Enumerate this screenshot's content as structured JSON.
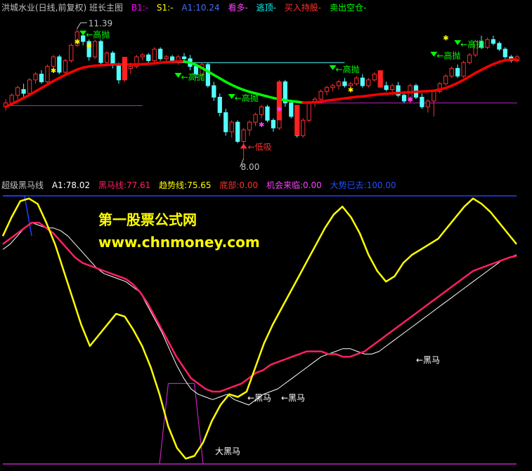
{
  "top_header": {
    "title": "洪城水业(日线,前复权) 班长主图",
    "b1": "B1:-",
    "s1": "S1:-",
    "a1": "A1:10.24",
    "kan_duo": "看多-",
    "tao_ding": "逃顶-",
    "buy_hold": "买入持股-",
    "sell_clear": "卖出空仓-"
  },
  "bottom_header": {
    "title": "超级黑马线",
    "a1": "A1:78.02",
    "heima_line": "黑马线:77.61",
    "trend_line": "趋势线:75.65",
    "bottom": "底部:0.00",
    "chance": "机会来临:0.00",
    "rise": "大势已去:100.00"
  },
  "watermark": {
    "line1": "第一股票公式网",
    "line2": "www.chnmoney.com"
  },
  "colors": {
    "up": "#ff3030",
    "down": "#54ffff",
    "trend_up": "#ff0000",
    "trend_down": "#00ff00",
    "yellow": "#ffff00",
    "white": "#ffffff",
    "crimson": "#ff2060",
    "blue": "#2040ff",
    "magenta": "#c020c0"
  },
  "annotations": {
    "high_price": "11.39",
    "low_price": "8.00",
    "low_buy": "低吸",
    "high_sell": "高抛",
    "dark_horse": "黑马",
    "big_dark_horse": "大黑马"
  },
  "chart_data": [
    {
      "type": "candlestick",
      "title": "洪城水业(日线,前复权) 班长主图",
      "ylim": [
        7.6,
        11.8
      ],
      "max_label": 11.39,
      "min_label": 8.0,
      "candles": [
        [
          9.35,
          9.55,
          9.25,
          9.45
        ],
        [
          9.45,
          9.7,
          9.4,
          9.65
        ],
        [
          9.65,
          9.9,
          9.55,
          9.85
        ],
        [
          9.8,
          9.95,
          9.6,
          9.7
        ],
        [
          9.7,
          10.1,
          9.65,
          10.05
        ],
        [
          10.05,
          10.25,
          9.95,
          10.2
        ],
        [
          10.2,
          10.3,
          9.95,
          10.0
        ],
        [
          10.0,
          10.45,
          9.95,
          10.4
        ],
        [
          10.4,
          10.7,
          10.3,
          10.65
        ],
        [
          10.65,
          10.7,
          10.2,
          10.25
        ],
        [
          10.25,
          10.6,
          10.2,
          10.55
        ],
        [
          10.55,
          11.0,
          10.5,
          10.95
        ],
        [
          10.95,
          11.39,
          10.9,
          11.3
        ],
        [
          11.2,
          11.3,
          10.95,
          11.05
        ],
        [
          11.05,
          11.1,
          10.55,
          10.65
        ],
        [
          10.65,
          11.1,
          10.6,
          11.05
        ],
        [
          11.05,
          11.1,
          10.45,
          10.5
        ],
        [
          10.5,
          10.8,
          10.45,
          10.75
        ],
        [
          10.75,
          10.8,
          10.35,
          10.45
        ],
        [
          10.45,
          10.5,
          9.95,
          10.05
        ],
        [
          10.05,
          10.4,
          10.0,
          10.35
        ],
        [
          10.35,
          10.5,
          10.2,
          10.4
        ],
        [
          10.4,
          10.7,
          10.35,
          10.65
        ],
        [
          10.65,
          10.75,
          10.55,
          10.7
        ],
        [
          10.7,
          10.75,
          10.5,
          10.55
        ],
        [
          10.55,
          10.9,
          10.5,
          10.85
        ],
        [
          10.85,
          10.9,
          10.55,
          10.6
        ],
        [
          10.6,
          10.7,
          10.5,
          10.65
        ],
        [
          10.65,
          10.7,
          10.5,
          10.55
        ],
        [
          10.55,
          10.7,
          10.45,
          10.65
        ],
        [
          10.65,
          10.75,
          10.55,
          10.6
        ],
        [
          10.6,
          10.7,
          10.3,
          10.4
        ],
        [
          10.4,
          10.45,
          10.1,
          10.2
        ],
        [
          10.2,
          10.5,
          10.15,
          10.45
        ],
        [
          10.45,
          10.5,
          9.85,
          9.9
        ],
        [
          9.9,
          10.0,
          9.5,
          9.6
        ],
        [
          9.6,
          9.7,
          9.1,
          9.2
        ],
        [
          9.2,
          9.3,
          8.6,
          8.7
        ],
        [
          8.7,
          9.0,
          8.55,
          8.95
        ],
        [
          8.95,
          9.0,
          8.4,
          8.45
        ],
        [
          8.45,
          8.8,
          8.0,
          8.75
        ],
        [
          8.75,
          9.0,
          8.6,
          8.95
        ],
        [
          8.95,
          9.2,
          8.85,
          9.15
        ],
        [
          9.15,
          9.4,
          9.05,
          9.35
        ],
        [
          9.35,
          9.4,
          8.95,
          9.0
        ],
        [
          9.0,
          9.05,
          8.7,
          8.8
        ],
        [
          8.8,
          10.05,
          8.75,
          10.0
        ],
        [
          10.0,
          10.05,
          9.35,
          9.45
        ],
        [
          9.45,
          9.5,
          9.05,
          9.1
        ],
        [
          9.1,
          9.2,
          8.55,
          8.6
        ],
        [
          8.6,
          9.05,
          8.55,
          9.0
        ],
        [
          9.0,
          9.5,
          8.95,
          9.45
        ],
        [
          9.45,
          9.6,
          9.35,
          9.55
        ],
        [
          9.55,
          9.8,
          9.5,
          9.75
        ],
        [
          9.75,
          9.9,
          9.65,
          9.85
        ],
        [
          9.85,
          9.95,
          9.75,
          9.9
        ],
        [
          9.9,
          10.05,
          9.8,
          10.0
        ],
        [
          10.0,
          10.1,
          9.85,
          9.9
        ],
        [
          9.9,
          10.0,
          9.8,
          9.95
        ],
        [
          9.95,
          10.15,
          9.9,
          10.1
        ],
        [
          10.1,
          10.2,
          9.85,
          9.9
        ],
        [
          9.9,
          10.1,
          9.85,
          10.05
        ],
        [
          10.05,
          10.25,
          10.0,
          10.2
        ],
        [
          10.2,
          10.3,
          9.85,
          9.9
        ],
        [
          9.9,
          10.0,
          9.75,
          9.8
        ],
        [
          9.8,
          9.95,
          9.7,
          9.9
        ],
        [
          9.9,
          10.0,
          9.6,
          9.65
        ],
        [
          9.65,
          9.7,
          9.45,
          9.5
        ],
        [
          9.5,
          9.95,
          9.45,
          9.9
        ],
        [
          9.9,
          9.95,
          9.55,
          9.6
        ],
        [
          9.6,
          9.7,
          9.3,
          9.35
        ],
        [
          9.35,
          9.55,
          9.2,
          9.5
        ],
        [
          9.5,
          9.8,
          9.1,
          9.75
        ],
        [
          9.75,
          10.0,
          9.7,
          9.95
        ],
        [
          9.95,
          10.2,
          9.9,
          10.15
        ],
        [
          10.15,
          10.4,
          10.1,
          10.35
        ],
        [
          10.35,
          10.45,
          10.1,
          10.15
        ],
        [
          10.15,
          10.55,
          10.1,
          10.5
        ],
        [
          10.5,
          10.75,
          10.45,
          10.7
        ],
        [
          10.7,
          11.1,
          10.65,
          11.05
        ],
        [
          11.05,
          11.2,
          10.85,
          10.9
        ],
        [
          10.9,
          11.15,
          10.85,
          11.1
        ],
        [
          11.1,
          11.2,
          10.95,
          11.0
        ],
        [
          11.0,
          11.05,
          10.8,
          10.85
        ],
        [
          10.85,
          10.9,
          10.6,
          10.65
        ],
        [
          10.65,
          10.7,
          10.5,
          10.55
        ],
        [
          10.55,
          10.7,
          10.5,
          10.65
        ]
      ],
      "trend_line": [
        9.35,
        9.42,
        9.5,
        9.58,
        9.66,
        9.75,
        9.84,
        9.93,
        10.02,
        10.1,
        10.18,
        10.25,
        10.32,
        10.37,
        10.4,
        10.42,
        10.43,
        10.44,
        10.45,
        10.45,
        10.45,
        10.45,
        10.45,
        10.46,
        10.47,
        10.48,
        10.5,
        10.51,
        10.52,
        10.53,
        10.53,
        10.5,
        10.44,
        10.36,
        10.27,
        10.18,
        10.09,
        10.0,
        9.92,
        9.85,
        9.79,
        9.74,
        9.7,
        9.66,
        9.62,
        9.58,
        9.55,
        9.52,
        9.5,
        9.48,
        9.46,
        9.46,
        9.47,
        9.49,
        9.51,
        9.53,
        9.55,
        9.57,
        9.59,
        9.61,
        9.62,
        9.64,
        9.66,
        9.68,
        9.69,
        9.7,
        9.71,
        9.72,
        9.73,
        9.74,
        9.75,
        9.76,
        9.77,
        9.8,
        9.84,
        9.9,
        9.97,
        10.05,
        10.14,
        10.23,
        10.31,
        10.39,
        10.46,
        10.52,
        10.56,
        10.58,
        10.58
      ],
      "trend_color_from_index": {
        "down_start": 30,
        "down_end": 50
      },
      "level_lines": [
        {
          "value": 9.38,
          "from": 0,
          "to": 23,
          "color": "#c020c0"
        },
        {
          "value": 10.5,
          "from": 26,
          "to": 57,
          "color": "#54ffff"
        },
        {
          "value": 9.45,
          "from": 50,
          "to": 86,
          "color": "#c020c0"
        }
      ]
    },
    {
      "type": "line",
      "title": "超级黑马线",
      "ylim": [
        0,
        100
      ],
      "series": [
        {
          "name": "A1",
          "color": "#ffffff",
          "values": [
            80,
            82,
            85,
            88,
            90,
            89,
            88,
            88,
            87,
            85,
            82,
            79,
            76,
            73,
            71,
            70,
            69,
            68,
            66,
            64,
            59,
            54,
            49,
            43,
            37,
            32,
            28,
            26,
            25,
            24,
            25,
            26,
            24,
            23,
            22,
            24,
            26,
            27,
            28,
            30,
            32,
            34,
            36,
            38,
            40,
            41,
            42,
            43,
            43,
            42,
            41,
            41,
            42,
            44,
            46,
            48,
            50,
            52,
            54,
            56,
            58,
            60,
            62,
            64,
            66,
            68,
            70,
            72,
            74,
            76,
            77,
            78
          ]
        },
        {
          "name": "黑马线",
          "color": "#ff2060",
          "values": [
            82,
            84,
            86,
            88,
            90,
            90,
            88,
            86,
            83,
            80,
            77,
            75,
            74,
            73,
            72,
            71,
            70,
            69,
            67,
            64,
            60,
            55,
            50,
            45,
            40,
            36,
            32,
            30,
            28,
            27,
            27,
            28,
            29,
            30,
            32,
            34,
            35,
            37,
            38,
            39,
            40,
            41,
            42,
            42,
            42,
            41,
            41,
            40,
            40,
            41,
            42,
            44,
            46,
            48,
            50,
            52,
            54,
            56,
            58,
            60,
            62,
            64,
            66,
            68,
            70,
            72,
            73,
            74,
            75,
            76,
            77,
            77.61
          ]
        },
        {
          "name": "A1-yellow",
          "color": "#ffff00",
          "values": [
            85,
            92,
            98,
            99,
            97,
            90,
            82,
            72,
            62,
            52,
            44,
            48,
            52,
            56,
            55,
            50,
            44,
            36,
            26,
            14,
            6,
            2,
            3,
            8,
            16,
            22,
            26,
            25,
            27,
            36,
            45,
            52,
            58,
            64,
            70,
            76,
            82,
            88,
            93,
            96,
            92,
            86,
            78,
            72,
            68,
            70,
            75,
            78,
            80,
            82,
            84,
            88,
            92,
            96,
            99,
            97,
            94,
            90,
            86,
            82
          ]
        }
      ],
      "bottom_line": 0,
      "rise_line": 100,
      "big_dark_horse_window": [
        18,
        23
      ]
    }
  ]
}
